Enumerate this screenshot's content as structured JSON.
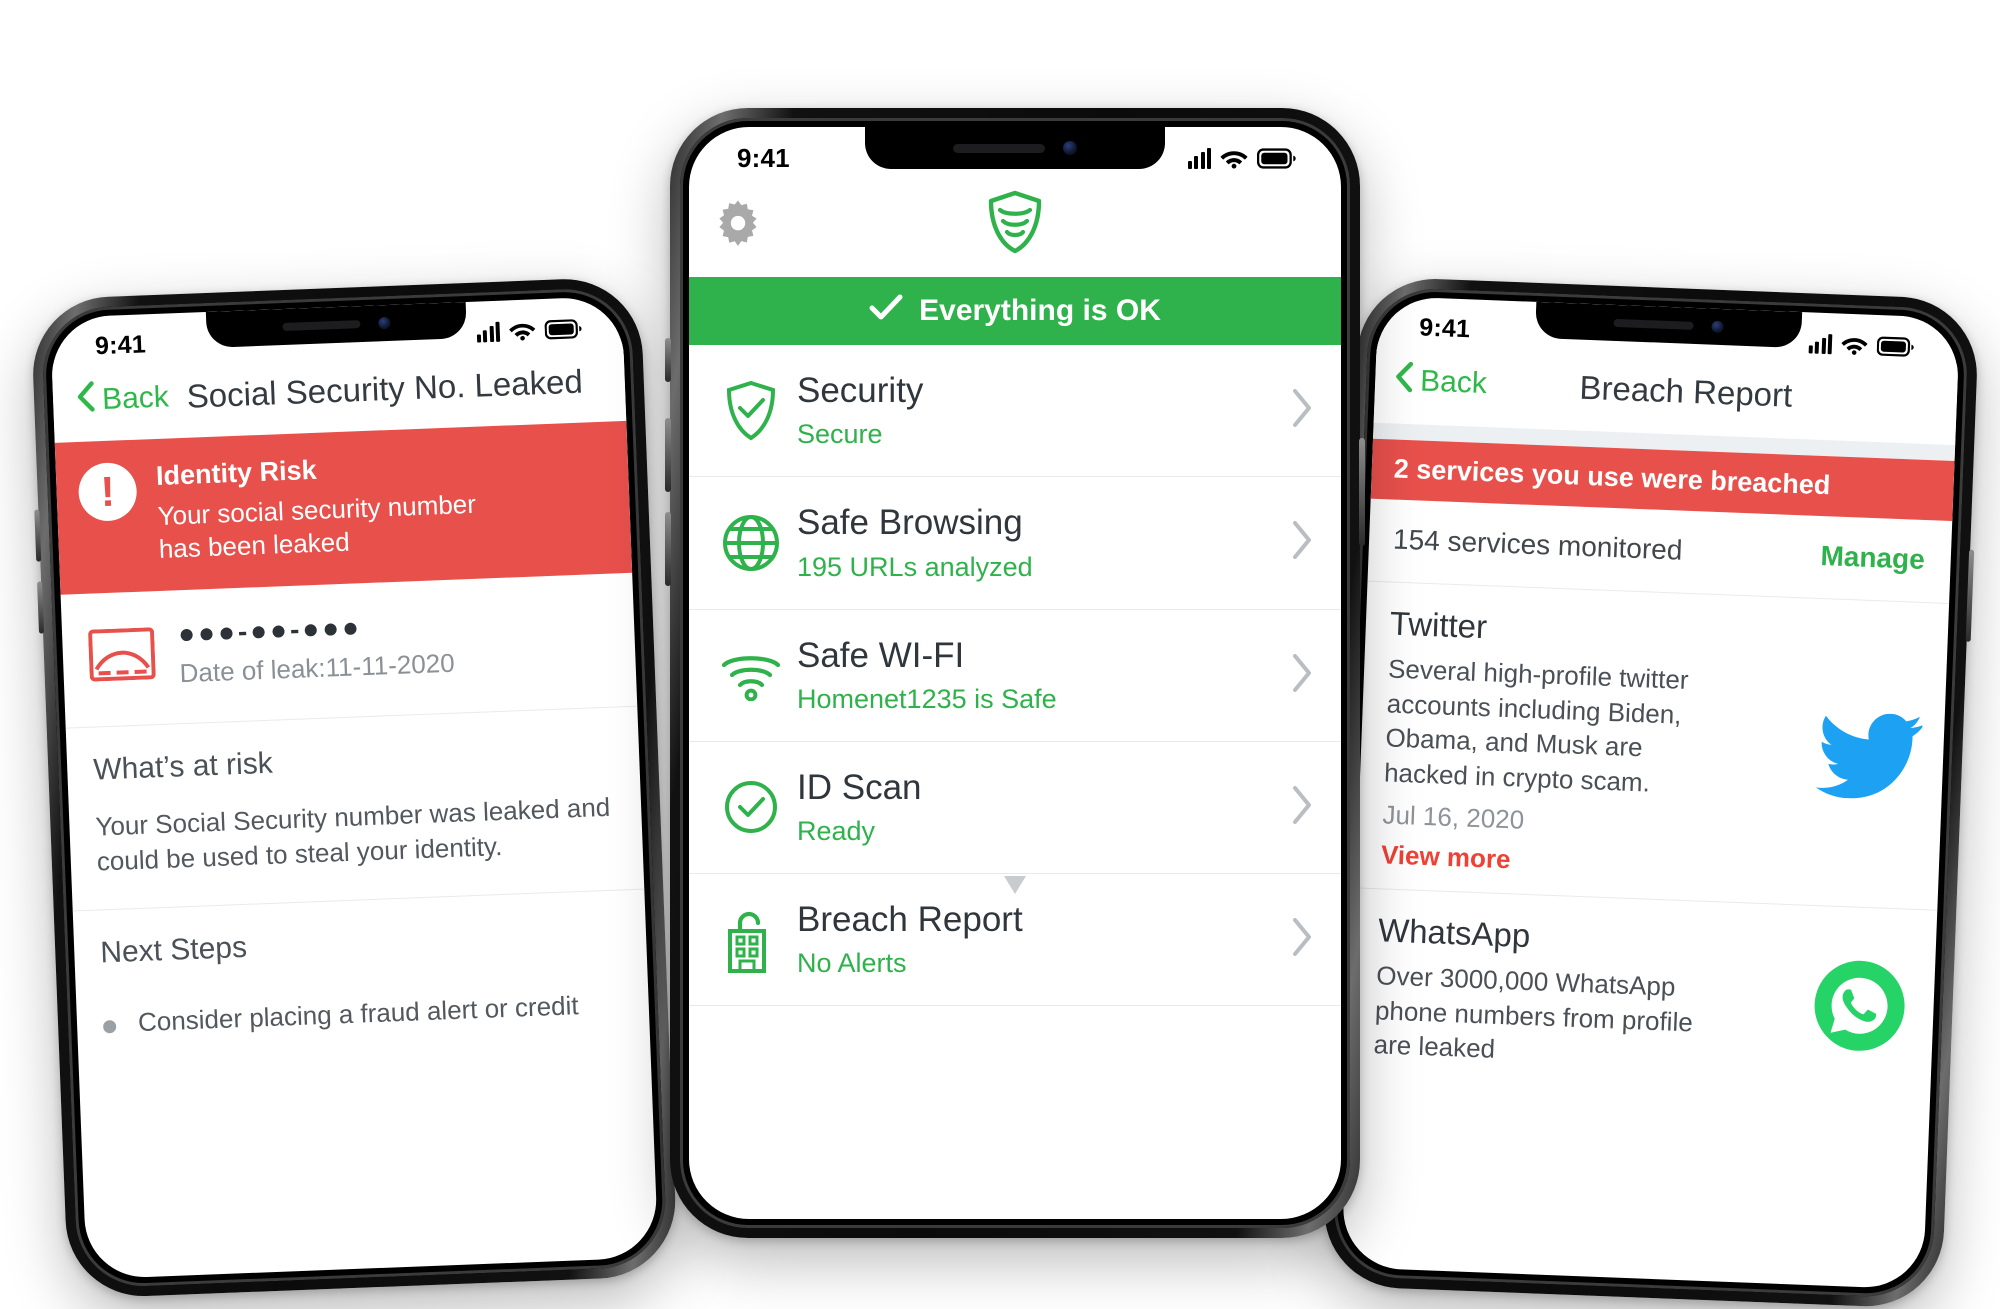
{
  "left_phone": {
    "status": {
      "time": "9:41"
    },
    "nav": {
      "back_label": "Back",
      "title": "Social Security No. Leaked"
    },
    "alert": {
      "icon": "exclamation-icon",
      "title": "Identity Risk",
      "description": "Your social security number has been leaked"
    },
    "ssn": {
      "icon": "id-card-icon",
      "masked_number": "●●●-●●-●●●",
      "date_of_leak": "Date of leak:11-11-2020"
    },
    "sections": [
      {
        "title": "What’s at risk",
        "body": "Your Social Security number was leaked and could be used to steal your identity."
      },
      {
        "title": "Next Steps",
        "bullet": "Consider placing a fraud alert or credit"
      }
    ]
  },
  "center_phone": {
    "status": {
      "time": "9:41"
    },
    "appbar": {
      "settings_icon": "gear-icon",
      "logo_icon": "shield-logo-icon"
    },
    "banner": {
      "icon": "check-icon",
      "text": "Everything is OK",
      "color": "#2fb24b"
    },
    "rows": [
      {
        "icon": "shield-check-icon",
        "title": "Security",
        "status": "Secure"
      },
      {
        "icon": "globe-icon",
        "title": "Safe Browsing",
        "status": "195 URLs analyzed"
      },
      {
        "icon": "wifi-icon",
        "title": "Safe WI-FI",
        "status": "Homenet1235 is Safe"
      },
      {
        "icon": "circle-check-icon",
        "title": "ID Scan",
        "status": "Ready"
      },
      {
        "icon": "building-lock-icon",
        "title": "Breach Report",
        "status": "No Alerts"
      }
    ],
    "chevron": "chevron-right-icon"
  },
  "right_phone": {
    "status": {
      "time": "9:41"
    },
    "nav": {
      "back_label": "Back",
      "title": "Breach Report"
    },
    "banner": {
      "text": "2 services you use were breached",
      "color": "#e8504c"
    },
    "monitor": {
      "count_label": "154 services monitored",
      "action_label": "Manage"
    },
    "breaches": [
      {
        "name": "Twitter",
        "description": "Several high-profile twitter accounts including Biden, Obama, and Musk are hacked in crypto scam.",
        "date": "Jul 16, 2020",
        "link": "View more",
        "logo": "twitter-bird-icon",
        "logo_color": "#1da1f2"
      },
      {
        "name": "WhatsApp",
        "description": "Over 3000,000 WhatsApp phone numbers from profile are leaked",
        "logo": "whatsapp-icon",
        "logo_color": "#25d366"
      }
    ]
  }
}
